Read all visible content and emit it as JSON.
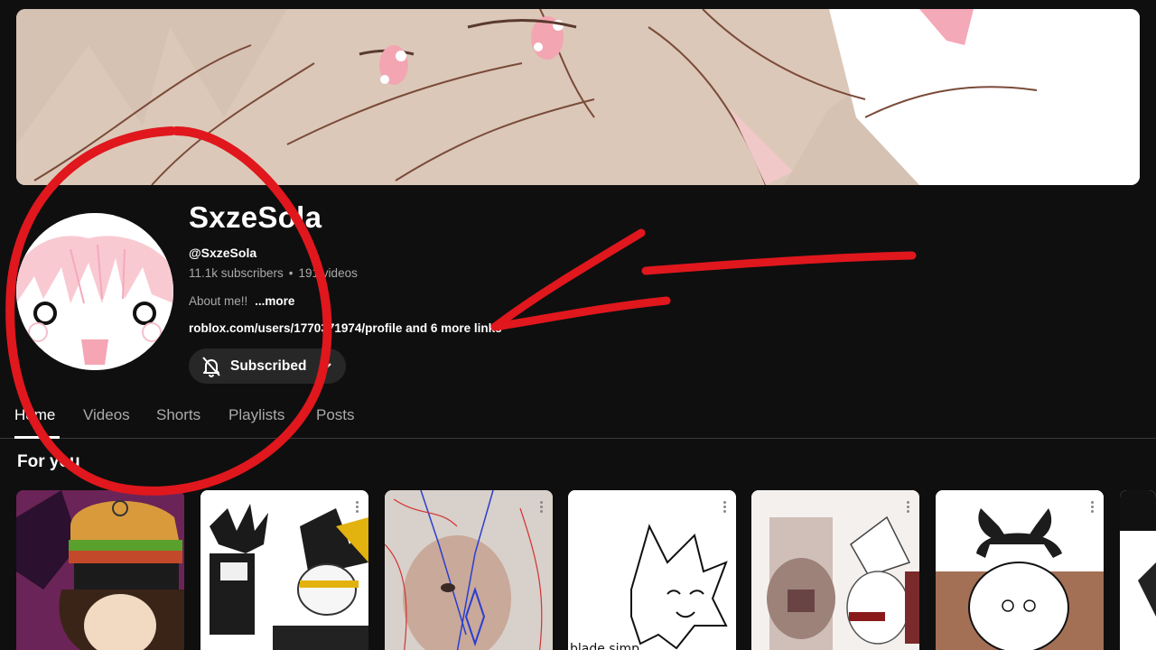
{
  "channel": {
    "name": "SxzeSola",
    "handle": "@SxzeSola",
    "subscribers": "11.1k subscribers",
    "separator": "•",
    "videos": "191 videos",
    "about": "About me!!",
    "about_more": "...more",
    "links": "roblox.com/users/1770371974/profile and 6 more links"
  },
  "subscribe_button": {
    "label": "Subscribed",
    "bell_icon": "bell-off-icon",
    "chevron_icon": "chevron-down-icon"
  },
  "tabs": [
    {
      "label": "Home",
      "active": true
    },
    {
      "label": "Videos",
      "active": false
    },
    {
      "label": "Shorts",
      "active": false
    },
    {
      "label": "Playlists",
      "active": false
    },
    {
      "label": "Posts",
      "active": false
    }
  ],
  "section": {
    "title": "For you"
  },
  "thumb_caption": "blade simp",
  "colors": {
    "background": "#0f0f0f",
    "button": "#272727",
    "annotation_red": "#e0171d",
    "text_secondary": "#aaaaaa"
  }
}
